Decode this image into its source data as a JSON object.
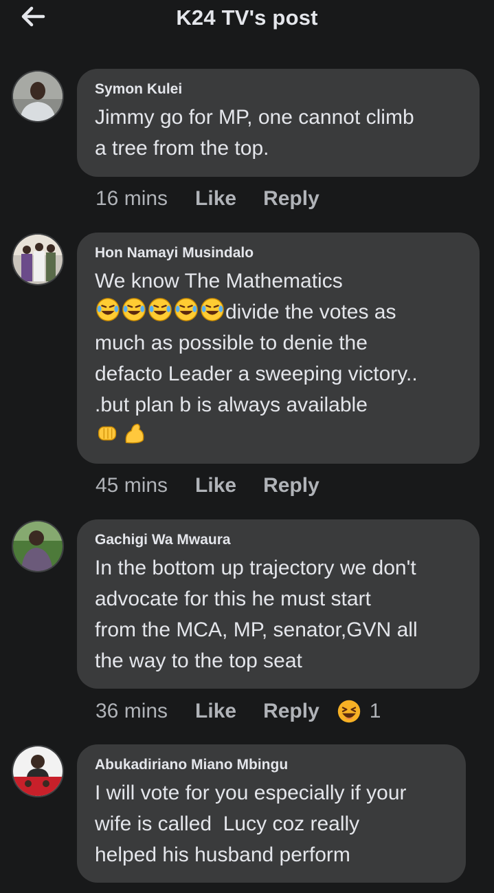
{
  "header": {
    "title": "K24 TV's post",
    "back_icon": "arrow-left-icon"
  },
  "comments": [
    {
      "author": "Symon Kulei",
      "text": "Jimmy go for MP, one cannot climb\na tree from the top.",
      "time": "16 mins",
      "like": "Like",
      "reply": "Reply"
    },
    {
      "author": "Hon Namayi Musindalo",
      "text_line1": "We know The Mathematics",
      "emojis_laugh": "🤣🤣🤣🤣🤣",
      "text_rest": "divide the votes as\nmuch as possible to denie the\ndefacto Leader a sweeping victory..\n.but plan b is always available",
      "emojis_end": "👊💪",
      "time": "45 mins",
      "like": "Like",
      "reply": "Reply"
    },
    {
      "author": "Gachigi Wa Mwaura",
      "text": "In the bottom up trajectory we don't\nadvocate for this he must start\nfrom the MCA, MP, senator,GVN all\nthe way to the top seat",
      "time": "36 mins",
      "like": "Like",
      "reply": "Reply",
      "reaction_icon": "haha-icon",
      "reaction_count": "1"
    },
    {
      "author": "Abukadiriano Miano Mbingu",
      "text": "I will vote for you especially if your\nwife is called  Lucy coz really\nhelped his husband perform"
    }
  ],
  "colors": {
    "background": "#18191a",
    "bubble": "#3a3b3c",
    "text": "#e4e6eb",
    "meta": "#b0b3b8"
  }
}
